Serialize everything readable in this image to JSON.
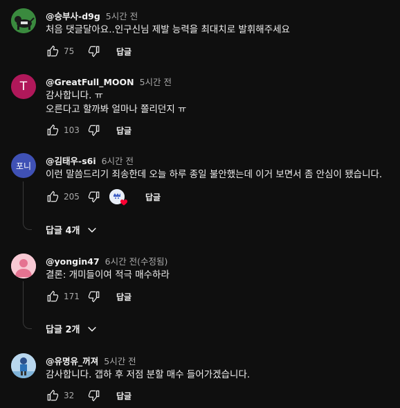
{
  "comments": [
    {
      "author": "@승부사-d9g",
      "time": "5시간 전",
      "lines": [
        "처음 댓글달아요..인구신님 제발 능력을 최대치로 발휘해주세요"
      ],
      "likes": "75",
      "reply_label": "답글",
      "avatar": {
        "type": "image",
        "bg": "#2e7d32",
        "icon": "dog-icon"
      }
    },
    {
      "author": "@GreatFull_MOON",
      "time": "5시간 전",
      "lines": [
        "감사합니다. ㅠ",
        "오른다고 할까봐 얼마나 쫄리던지 ㅠ"
      ],
      "likes": "103",
      "reply_label": "답글",
      "avatar": {
        "type": "letter",
        "letter": "T",
        "bg": "#b0185a"
      }
    },
    {
      "author": "@김태우-s6i",
      "time": "6시간 전",
      "lines": [
        "이런 말씀드리기 죄송한데 오늘 하루 종일 불안했는데 이거 보면서 좀 안심이 됐습니다."
      ],
      "likes": "205",
      "reply_label": "답글",
      "replies_label": "답글 4개",
      "avatar": {
        "type": "letter",
        "letter": "포니",
        "bg": "#3f51b5"
      }
    },
    {
      "author": "@yongin47",
      "time": "6시간 전(수정됨)",
      "lines": [
        "결론:  개미들이여 적극 매수하라"
      ],
      "likes": "171",
      "reply_label": "답글",
      "replies_label": "답글 2개",
      "avatar": {
        "type": "person",
        "bg": "#f8c9d4",
        "fg": "#e57391"
      }
    },
    {
      "author": "@유명유_꺼져",
      "time": "5시간 전",
      "lines": [
        "감사합니다. 갭하 후 저점 분할 매수 들어가겠습니다."
      ],
      "likes": "32",
      "reply_label": "답글",
      "avatar": {
        "type": "image",
        "bg": "#b9d7ee",
        "icon": "character-icon"
      }
    }
  ]
}
